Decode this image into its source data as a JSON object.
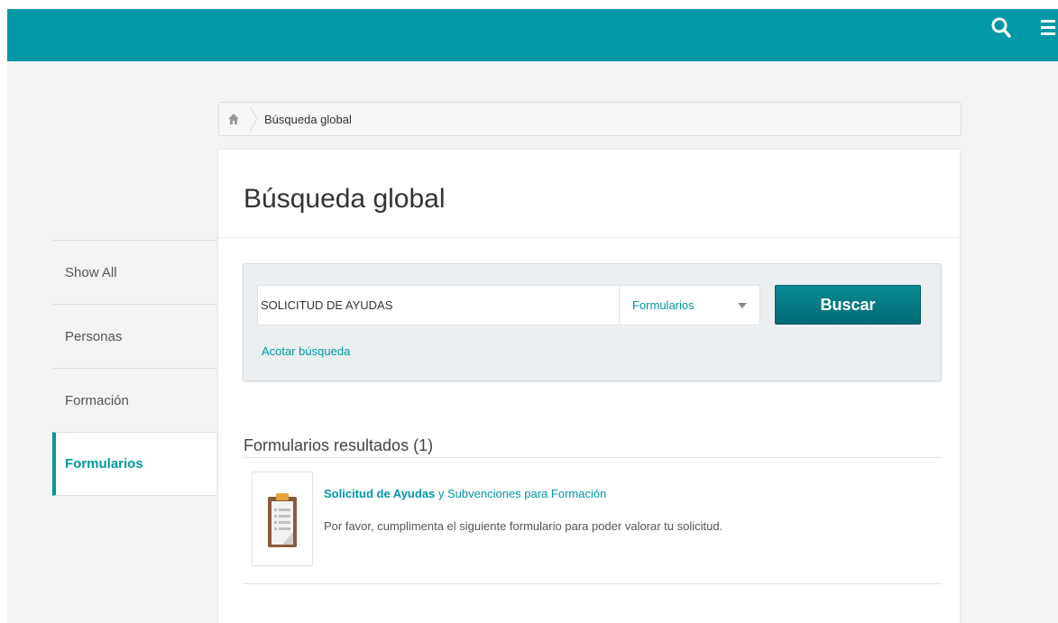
{
  "colors": {
    "accent": "#0097a7",
    "button": "#00747c",
    "background": "#f4f4f4"
  },
  "header": {
    "search_icon": "search-icon",
    "menu_icon": "hamburger-menu-icon"
  },
  "breadcrumb": {
    "home_icon": "home-icon",
    "current": "Búsqueda global"
  },
  "page": {
    "title": "Búsqueda global"
  },
  "sidebar": {
    "items": [
      {
        "label": "Show All",
        "active": false
      },
      {
        "label": "Personas",
        "active": false
      },
      {
        "label": "Formación",
        "active": false
      },
      {
        "label": "Formularios",
        "active": true
      }
    ]
  },
  "search": {
    "query": "SOLICITUD DE AYUDAS",
    "scope_selected": "Formularios",
    "button_label": "Buscar",
    "refine_label": "Acotar búsqueda"
  },
  "results": {
    "heading": "Formularios resultados (1)",
    "items": [
      {
        "icon": "clipboard-form-icon",
        "title_highlight": "Solicitud de Ayudas",
        "title_rest": " y Subvenciones para Formación",
        "description": "Por favor, cumplimenta el siguiente formulario para poder valorar tu solicitud."
      }
    ]
  }
}
